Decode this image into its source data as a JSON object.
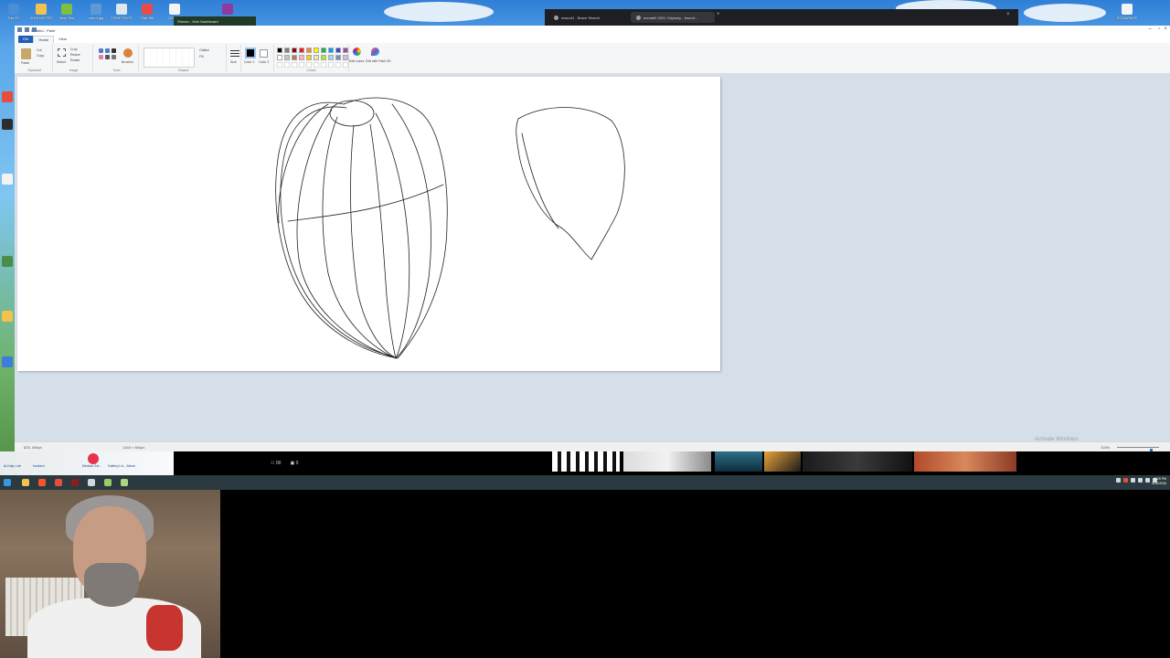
{
  "desktop": {
    "icons_top": [
      {
        "label": "This PC",
        "color": "#4a8fd8"
      },
      {
        "label": "2018 NOTES",
        "color": "#f2c14e"
      },
      {
        "label": "New Text",
        "color": "#7fbf3f"
      },
      {
        "label": "mirror.jpg",
        "color": "#5b9bd5"
      },
      {
        "label": "TEMP FILES",
        "color": "#dfe6ee"
      },
      {
        "label": "Rafi Blk",
        "color": "#e94b4b"
      },
      {
        "label": "1234.txt",
        "color": "#f4f4f4"
      },
      {
        "label": "WinRAR",
        "color": "#8e3b9e"
      }
    ],
    "icons_right": [
      {
        "label": "RODAPAGE",
        "color": "#f4f4f4"
      }
    ]
  },
  "browser": {
    "tabs": [
      {
        "label": "maxod1 - Brave Search"
      },
      {
        "label": "enmatt0 2001 Odyssey - bound..."
      }
    ],
    "new_tab": "+",
    "close": "×"
  },
  "dashboard_tab": {
    "label": "Stream - Kick Dashboard"
  },
  "paint": {
    "title": "Untitled - Paint",
    "menu_tabs": [
      "File",
      "Home",
      "View"
    ],
    "ribbon": {
      "clipboard": {
        "paste": "Paste",
        "cut": "Cut",
        "copy": "Copy",
        "group": "Clipboard"
      },
      "image": {
        "select": "Select",
        "crop": "Crop",
        "resize": "Resize",
        "rotate": "Rotate",
        "group": "Image"
      },
      "tools": {
        "brushes": "Brushes",
        "group": "Tools"
      },
      "shapes": {
        "outline": "Outline",
        "fill": "Fill",
        "group": "Shapes"
      },
      "size": "Size",
      "color1": "Color 1",
      "color2": "Color 2",
      "colors_group": "Colors",
      "edit_colors": "Edit colors",
      "edit_paint3d": "Edit with Paint 3D"
    },
    "palette": [
      "#000000",
      "#7f7f7f",
      "#880015",
      "#ed1c24",
      "#ff7f27",
      "#fff200",
      "#22b14c",
      "#00a2e8",
      "#3f48cc",
      "#a349a4",
      "#ffffff",
      "#c3c3c3",
      "#b97a57",
      "#ffaec9",
      "#ffc90e",
      "#efe4b0",
      "#b5e61d",
      "#99d9ea",
      "#7092be",
      "#c8bfe7"
    ],
    "status": {
      "position": "825, 406px",
      "canvas_size": "1344 × 664px",
      "zoom": "100%"
    },
    "zoom_level": 0.8,
    "watermark": "Activate Windows"
  },
  "overlay": {
    "left_labels": [
      "Ai-Kaiju Lab",
      "bunkerd",
      "Medium-1st...",
      "Gallery1 st... Album"
    ],
    "stats": [
      {
        "icon": "viewers",
        "value": "00"
      },
      {
        "icon": "followers",
        "value": "0"
      }
    ]
  },
  "taskbar": {
    "clock_time": "6:25 PM",
    "clock_date": "5/26/2026"
  }
}
